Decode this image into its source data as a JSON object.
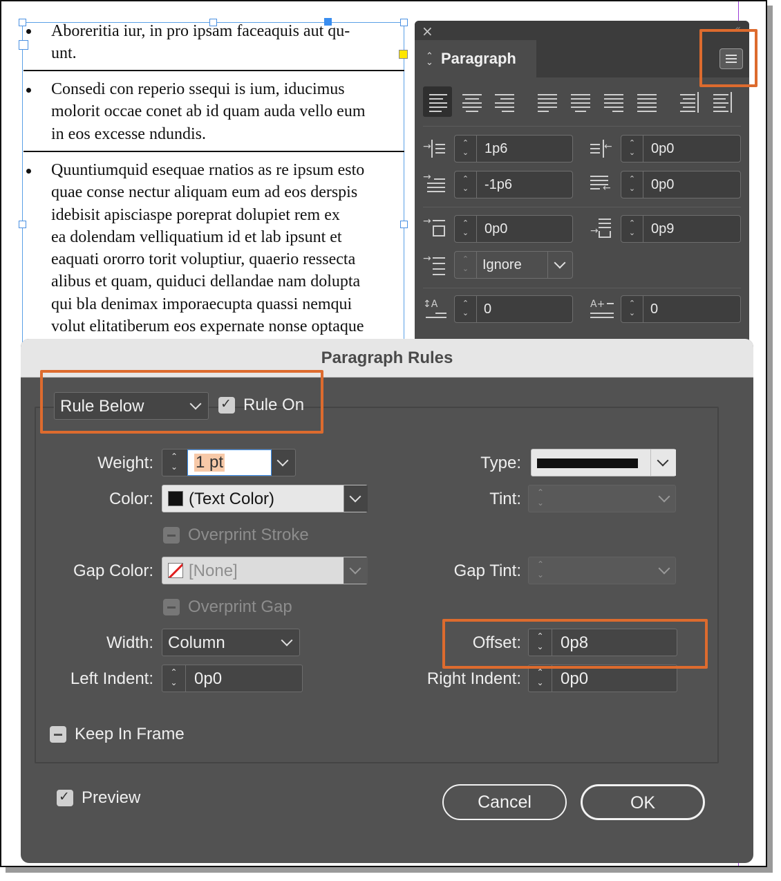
{
  "document": {
    "paragraphs": [
      {
        "lines": [
          "Aboreritia iur, in pro ipsam faceaquis aut qu-",
          "unt."
        ]
      },
      {
        "lines": [
          "Consedi con reperio ssequi is ium, iducimus",
          "molorit occae conet ab id quam auda vello eum",
          "in eos excesse ndundis."
        ]
      },
      {
        "lines": [
          "Quuntiumquid esequae rnatios as re ipsum esto",
          "quae conse nectur aliquam eum ad eos derspis",
          "idebisit apisciaspe poreprat dolupiet rem ex",
          "ea dolendam velliquatium id et lab ipsunt et",
          "eaquati ororro torit voluptiur, quaerio ressecta",
          "alibus et quam, quiduci dellandae nam dolupta",
          "qui bla denimax imporaecupta quassi nemqui",
          "volut elitatiberum eos expernate nonse optaque"
        ]
      }
    ]
  },
  "paragraph_panel": {
    "close_glyph": "×",
    "grip_glyph": "«",
    "tab_arrows": "⌃⌄",
    "title": "Paragraph",
    "left_indent": "1p6",
    "right_indent": "0p0",
    "first_line_indent": "-1p6",
    "last_line_indent": "0p0",
    "space_before": "0p0",
    "space_after": "0p9",
    "align_to_grid": "Ignore",
    "drop_cap_lines": "0",
    "drop_cap_chars": "0"
  },
  "dialog": {
    "title": "Paragraph Rules",
    "rule_select": "Rule Below",
    "rule_on_label": "Rule On",
    "rule_on_checked": true,
    "weight_label": "Weight:",
    "weight_value": "1 pt",
    "type_label": "Type:",
    "color_label": "Color:",
    "color_value": "(Text Color)",
    "tint_label": "Tint:",
    "overprint_stroke_label": "Overprint Stroke",
    "gap_color_label": "Gap Color:",
    "gap_color_value": "[None]",
    "gap_tint_label": "Gap Tint:",
    "overprint_gap_label": "Overprint Gap",
    "width_label": "Width:",
    "width_value": "Column",
    "offset_label": "Offset:",
    "offset_value": "0p8",
    "left_indent_label": "Left Indent:",
    "left_indent_value": "0p0",
    "right_indent_label": "Right Indent:",
    "right_indent_value": "0p0",
    "keep_in_frame_label": "Keep In Frame",
    "preview_label": "Preview",
    "preview_checked": true,
    "cancel_label": "Cancel",
    "ok_label": "OK",
    "check_glyph": "✓",
    "spin_glyph": "⌃⌄"
  },
  "colors": {
    "highlight": "#dd6b2e",
    "panel_bg": "#4b4b4b",
    "dialog_bg": "#525252",
    "selection_blue": "#3a8ef0"
  }
}
